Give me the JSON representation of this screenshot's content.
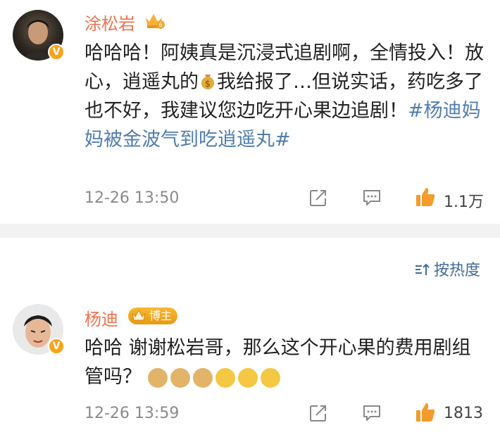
{
  "comments": [
    {
      "author": "涂松岩",
      "text_part1": "哈哈哈！阿姨真是沉浸式追剧啊，全情投入！放心，逍遥丸的",
      "text_part2": "我给报了…但说实话，药吃多了也不好，我建议您边吃开心果边追剧！",
      "topic": "#杨迪妈妈被金波气到吃逍遥丸#",
      "time": "12-26 13:50",
      "likes": "1.1万",
      "verified": "V"
    },
    {
      "author": "杨迪",
      "badge": "博主",
      "text": "哈哈 谢谢松岩哥，那么这个开心果的费用剧组管吗？",
      "time": "12-26 13:59",
      "likes": "1813",
      "verified": "V"
    }
  ],
  "sort_label": "按热度",
  "colors": {
    "accent": "#eb7350",
    "topic": "#507daf",
    "like": "#f39b2b",
    "badge": "#f5a41b"
  }
}
